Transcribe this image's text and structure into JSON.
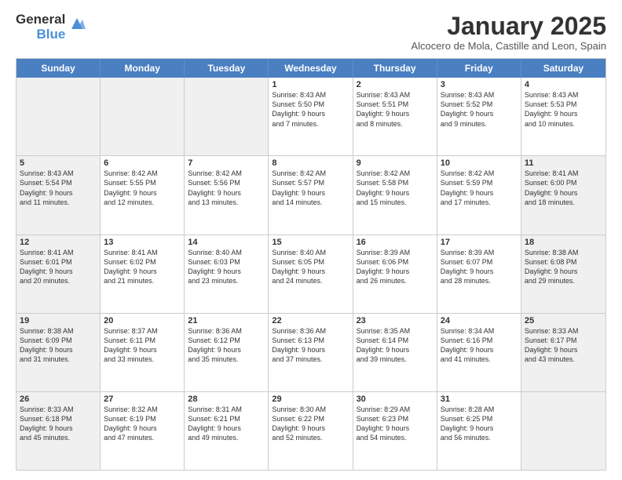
{
  "logo": {
    "line1": "General",
    "line2": "Blue"
  },
  "title": "January 2025",
  "subtitle": "Alcocero de Mola, Castille and Leon, Spain",
  "headers": [
    "Sunday",
    "Monday",
    "Tuesday",
    "Wednesday",
    "Thursday",
    "Friday",
    "Saturday"
  ],
  "rows": [
    [
      {
        "day": "",
        "info": "",
        "shaded": true
      },
      {
        "day": "",
        "info": "",
        "shaded": true
      },
      {
        "day": "",
        "info": "",
        "shaded": true
      },
      {
        "day": "1",
        "info": "Sunrise: 8:43 AM\nSunset: 5:50 PM\nDaylight: 9 hours\nand 7 minutes.",
        "shaded": false
      },
      {
        "day": "2",
        "info": "Sunrise: 8:43 AM\nSunset: 5:51 PM\nDaylight: 9 hours\nand 8 minutes.",
        "shaded": false
      },
      {
        "day": "3",
        "info": "Sunrise: 8:43 AM\nSunset: 5:52 PM\nDaylight: 9 hours\nand 9 minutes.",
        "shaded": false
      },
      {
        "day": "4",
        "info": "Sunrise: 8:43 AM\nSunset: 5:53 PM\nDaylight: 9 hours\nand 10 minutes.",
        "shaded": false
      }
    ],
    [
      {
        "day": "5",
        "info": "Sunrise: 8:43 AM\nSunset: 5:54 PM\nDaylight: 9 hours\nand 11 minutes.",
        "shaded": true
      },
      {
        "day": "6",
        "info": "Sunrise: 8:42 AM\nSunset: 5:55 PM\nDaylight: 9 hours\nand 12 minutes.",
        "shaded": false
      },
      {
        "day": "7",
        "info": "Sunrise: 8:42 AM\nSunset: 5:56 PM\nDaylight: 9 hours\nand 13 minutes.",
        "shaded": false
      },
      {
        "day": "8",
        "info": "Sunrise: 8:42 AM\nSunset: 5:57 PM\nDaylight: 9 hours\nand 14 minutes.",
        "shaded": false
      },
      {
        "day": "9",
        "info": "Sunrise: 8:42 AM\nSunset: 5:58 PM\nDaylight: 9 hours\nand 15 minutes.",
        "shaded": false
      },
      {
        "day": "10",
        "info": "Sunrise: 8:42 AM\nSunset: 5:59 PM\nDaylight: 9 hours\nand 17 minutes.",
        "shaded": false
      },
      {
        "day": "11",
        "info": "Sunrise: 8:41 AM\nSunset: 6:00 PM\nDaylight: 9 hours\nand 18 minutes.",
        "shaded": true
      }
    ],
    [
      {
        "day": "12",
        "info": "Sunrise: 8:41 AM\nSunset: 6:01 PM\nDaylight: 9 hours\nand 20 minutes.",
        "shaded": true
      },
      {
        "day": "13",
        "info": "Sunrise: 8:41 AM\nSunset: 6:02 PM\nDaylight: 9 hours\nand 21 minutes.",
        "shaded": false
      },
      {
        "day": "14",
        "info": "Sunrise: 8:40 AM\nSunset: 6:03 PM\nDaylight: 9 hours\nand 23 minutes.",
        "shaded": false
      },
      {
        "day": "15",
        "info": "Sunrise: 8:40 AM\nSunset: 6:05 PM\nDaylight: 9 hours\nand 24 minutes.",
        "shaded": false
      },
      {
        "day": "16",
        "info": "Sunrise: 8:39 AM\nSunset: 6:06 PM\nDaylight: 9 hours\nand 26 minutes.",
        "shaded": false
      },
      {
        "day": "17",
        "info": "Sunrise: 8:39 AM\nSunset: 6:07 PM\nDaylight: 9 hours\nand 28 minutes.",
        "shaded": false
      },
      {
        "day": "18",
        "info": "Sunrise: 8:38 AM\nSunset: 6:08 PM\nDaylight: 9 hours\nand 29 minutes.",
        "shaded": true
      }
    ],
    [
      {
        "day": "19",
        "info": "Sunrise: 8:38 AM\nSunset: 6:09 PM\nDaylight: 9 hours\nand 31 minutes.",
        "shaded": true
      },
      {
        "day": "20",
        "info": "Sunrise: 8:37 AM\nSunset: 6:11 PM\nDaylight: 9 hours\nand 33 minutes.",
        "shaded": false
      },
      {
        "day": "21",
        "info": "Sunrise: 8:36 AM\nSunset: 6:12 PM\nDaylight: 9 hours\nand 35 minutes.",
        "shaded": false
      },
      {
        "day": "22",
        "info": "Sunrise: 8:36 AM\nSunset: 6:13 PM\nDaylight: 9 hours\nand 37 minutes.",
        "shaded": false
      },
      {
        "day": "23",
        "info": "Sunrise: 8:35 AM\nSunset: 6:14 PM\nDaylight: 9 hours\nand 39 minutes.",
        "shaded": false
      },
      {
        "day": "24",
        "info": "Sunrise: 8:34 AM\nSunset: 6:16 PM\nDaylight: 9 hours\nand 41 minutes.",
        "shaded": false
      },
      {
        "day": "25",
        "info": "Sunrise: 8:33 AM\nSunset: 6:17 PM\nDaylight: 9 hours\nand 43 minutes.",
        "shaded": true
      }
    ],
    [
      {
        "day": "26",
        "info": "Sunrise: 8:33 AM\nSunset: 6:18 PM\nDaylight: 9 hours\nand 45 minutes.",
        "shaded": true
      },
      {
        "day": "27",
        "info": "Sunrise: 8:32 AM\nSunset: 6:19 PM\nDaylight: 9 hours\nand 47 minutes.",
        "shaded": false
      },
      {
        "day": "28",
        "info": "Sunrise: 8:31 AM\nSunset: 6:21 PM\nDaylight: 9 hours\nand 49 minutes.",
        "shaded": false
      },
      {
        "day": "29",
        "info": "Sunrise: 8:30 AM\nSunset: 6:22 PM\nDaylight: 9 hours\nand 52 minutes.",
        "shaded": false
      },
      {
        "day": "30",
        "info": "Sunrise: 8:29 AM\nSunset: 6:23 PM\nDaylight: 9 hours\nand 54 minutes.",
        "shaded": false
      },
      {
        "day": "31",
        "info": "Sunrise: 8:28 AM\nSunset: 6:25 PM\nDaylight: 9 hours\nand 56 minutes.",
        "shaded": false
      },
      {
        "day": "",
        "info": "",
        "shaded": true
      }
    ]
  ]
}
